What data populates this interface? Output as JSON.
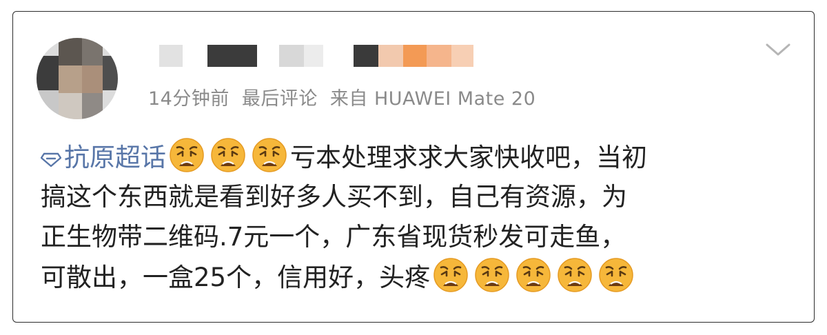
{
  "post": {
    "meta": {
      "time": "14分钟前",
      "tag": "最后评论",
      "source": "来自 HUAWEI Mate 20"
    },
    "topic_label": "抗原超话",
    "lines": [
      "亏本处理求求大家快收吧，当初",
      "搞这个东西就是看到好多人买不到，自己有资源，为",
      "正生物带二维码.7元一个，广东省现货秒发可走鱼，",
      "可散出，一盒25个，信用好，头疼"
    ]
  },
  "icons": {
    "topic": "diamond-topic-icon",
    "emoji": "weary-face-emoji",
    "chevron": "chevron-down-icon"
  },
  "colors": {
    "topic": "#5876a8",
    "meta": "#8a8a8a",
    "text": "#222222",
    "emoji": "#f6b73a"
  }
}
